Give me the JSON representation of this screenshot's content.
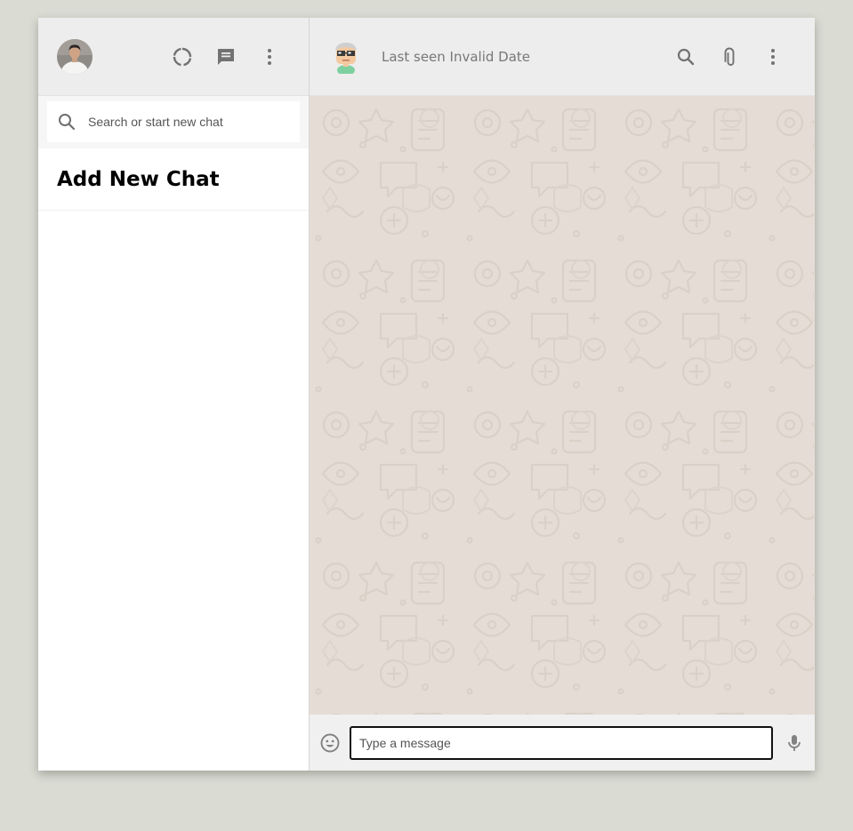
{
  "sidebar": {
    "header": {
      "icons": [
        "status-icon",
        "new-chat-icon",
        "menu-icon"
      ]
    },
    "search": {
      "placeholder": "Search or start new chat"
    },
    "add_chat_label": "Add New Chat"
  },
  "chat": {
    "header": {
      "last_seen": "Last seen Invalid Date",
      "icons": [
        "search-icon",
        "attach-icon",
        "menu-icon"
      ]
    },
    "footer": {
      "placeholder": "Type a message",
      "icons": [
        "emoji-icon",
        "mic-icon"
      ]
    }
  },
  "colors": {
    "page_bg": "#dadbd3",
    "header_bg": "#ededed",
    "chat_bg": "#e5ddd5",
    "icon": "#919191"
  }
}
